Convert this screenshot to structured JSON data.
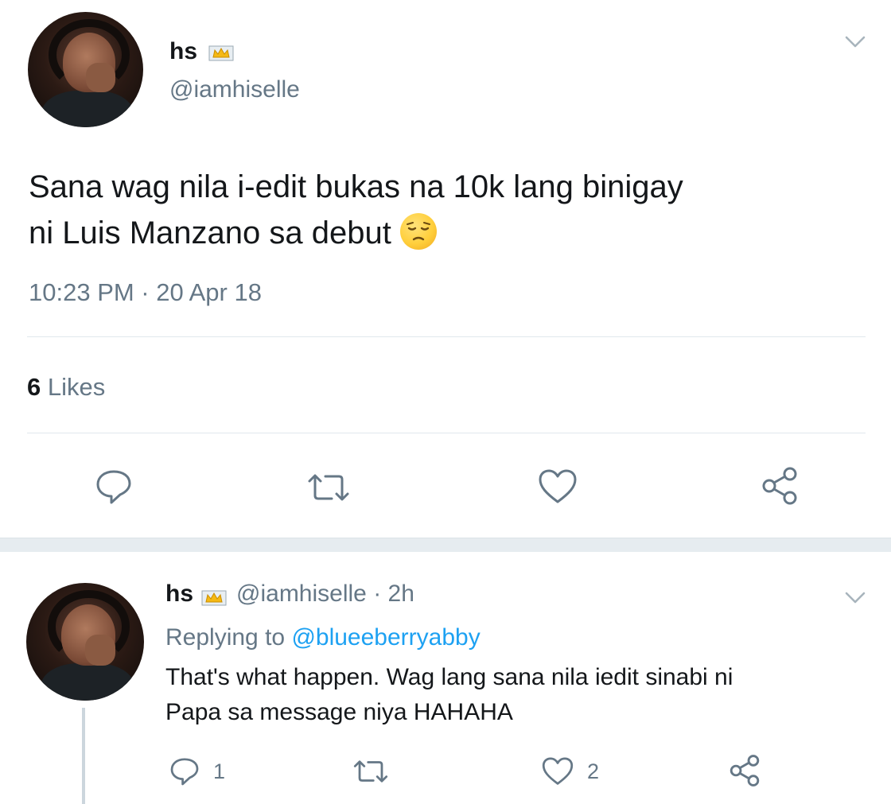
{
  "main_tweet": {
    "display_name": "hs",
    "handle": "@iamhiselle",
    "text_line1": "Sana wag nila i-edit bukas na 10k lang binigay",
    "text_line2": "ni Luis Manzano sa debut",
    "timestamp": "10:23 PM · 20 Apr 18",
    "likes_count": "6",
    "likes_label": "Likes",
    "icons": [
      "reply-icon",
      "retweet-icon",
      "like-icon",
      "share-icon"
    ]
  },
  "reply": {
    "display_name": "hs",
    "handle_time": "@iamhiselle · 2h",
    "replying_prefix": "Replying to",
    "replying_mention": "@blueeberryabby",
    "text_line1": "That's what happen. Wag lang sana nila iedit sinabi ni",
    "text_line2": "Papa sa message niya HAHAHA",
    "reply_count": "1",
    "like_count": "2"
  },
  "colors": {
    "text_primary": "#14171a",
    "text_secondary": "#657786",
    "link": "#1da1f2",
    "divider": "#e1e8ed",
    "band": "#e6ecf0"
  }
}
